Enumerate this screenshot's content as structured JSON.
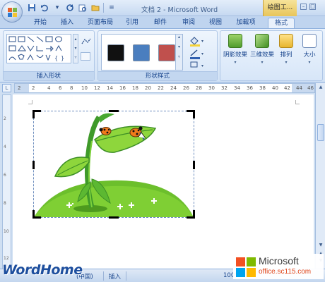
{
  "titlebar": {
    "document_title": "文档 2 - Microsoft Word",
    "context_tool_title": "绘图工..."
  },
  "tabs": [
    {
      "label": "开始"
    },
    {
      "label": "插入"
    },
    {
      "label": "页面布局"
    },
    {
      "label": "引用"
    },
    {
      "label": "邮件"
    },
    {
      "label": "审阅"
    },
    {
      "label": "视图"
    },
    {
      "label": "加载项"
    },
    {
      "label": "格式"
    }
  ],
  "ribbon": {
    "insert_shapes_label": "插入形状",
    "shape_styles_label": "形状样式",
    "shadow_effects": "阴影效果",
    "3d_effects": "三维效果",
    "arrange": "排列",
    "size": "大小",
    "style_swatches": [
      {
        "name": "black",
        "color": "#111111"
      },
      {
        "name": "blue",
        "color": "#4a7ebf"
      },
      {
        "name": "red",
        "color": "#c0504d"
      }
    ]
  },
  "ruler": {
    "numbers": [
      "2",
      "2",
      "4",
      "6",
      "8",
      "10",
      "12",
      "14",
      "16",
      "18",
      "20",
      "22",
      "24",
      "26",
      "28",
      "30",
      "32",
      "34",
      "36",
      "38",
      "40",
      "42",
      "44",
      "46"
    ]
  },
  "vruler": {
    "numbers": [
      "2",
      "4",
      "6",
      "8",
      "10",
      "12"
    ]
  },
  "statusbar": {
    "language": "(中国)",
    "mode": "插入",
    "zoom": "100%"
  },
  "watermarks": {
    "wordhome": "WordHome",
    "microsoft": "Microsoft",
    "site": "office.sc115.com"
  }
}
